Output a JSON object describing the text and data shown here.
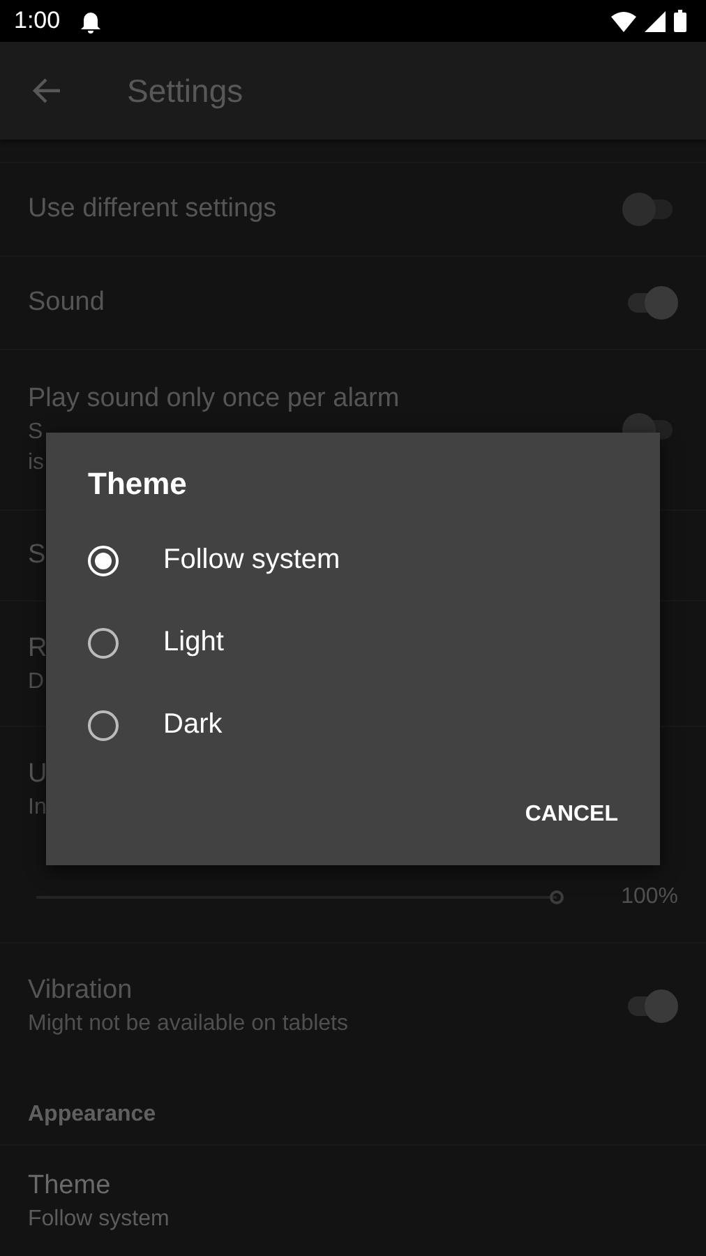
{
  "status_bar": {
    "time": "1:00"
  },
  "app_bar": {
    "title": "Settings"
  },
  "settings": [
    {
      "kind": "toggle",
      "title": "Use different settings",
      "on": false
    },
    {
      "kind": "toggle",
      "title": "Sound",
      "on": true
    },
    {
      "kind": "toggle",
      "title": "Play sound only once per alarm",
      "subtitle": [
        "S",
        "is"
      ],
      "on": false
    },
    {
      "kind": "text",
      "title": "S"
    },
    {
      "kind": "text",
      "title": "R",
      "subtitle": [
        "D"
      ]
    },
    {
      "kind": "text",
      "title": "U",
      "subtitle": [
        "In"
      ]
    },
    {
      "kind": "slider",
      "level": 1,
      "reading": "100%"
    },
    {
      "kind": "toggle",
      "title": "Vibration",
      "subtitle": [
        "Might not be available on tablets"
      ],
      "on": true
    },
    {
      "kind": "header",
      "title": "Appearance"
    },
    {
      "kind": "text",
      "title": "Theme",
      "subtitle": [
        "Follow system"
      ],
      "bright": true
    }
  ],
  "dialog": {
    "title": "Theme",
    "options": [
      {
        "label": "Follow system",
        "selected": true
      },
      {
        "label": "Light",
        "selected": false
      },
      {
        "label": "Dark",
        "selected": false
      }
    ],
    "button": "CANCEL"
  }
}
